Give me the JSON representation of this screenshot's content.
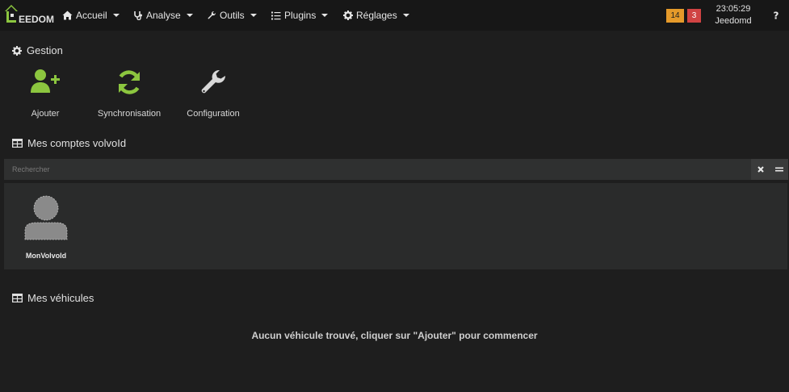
{
  "navbar": {
    "logo_text": "EEDOM",
    "menus": [
      {
        "label": "Accueil",
        "icon": "home-icon"
      },
      {
        "label": "Analyse",
        "icon": "stethoscope-icon"
      },
      {
        "label": "Outils",
        "icon": "wrench-icon"
      },
      {
        "label": "Plugins",
        "icon": "list-icon"
      },
      {
        "label": "Réglages",
        "icon": "cog-icon"
      }
    ],
    "badges": {
      "messages": "14",
      "alerts": "3"
    },
    "time": "23:05:29",
    "hostname": "Jeedomd",
    "colors": {
      "badge_orange": "#e59a2a",
      "badge_red": "#d04343"
    }
  },
  "gestion": {
    "title": "Gestion",
    "actions": [
      {
        "label": "Ajouter",
        "icon": "user-plus-icon"
      },
      {
        "label": "Synchronisation",
        "icon": "sync-icon"
      },
      {
        "label": "Configuration",
        "icon": "wrench-icon"
      }
    ],
    "accent_color": "#8cc63f"
  },
  "accounts": {
    "title": "Mes comptes volvoId",
    "search_placeholder": "Rechercher",
    "items": [
      {
        "name": "MonVolvoId"
      }
    ]
  },
  "vehicles": {
    "title": "Mes véhicules",
    "empty_message": "Aucun véhicule trouvé, cliquer sur \"Ajouter\" pour commencer"
  }
}
